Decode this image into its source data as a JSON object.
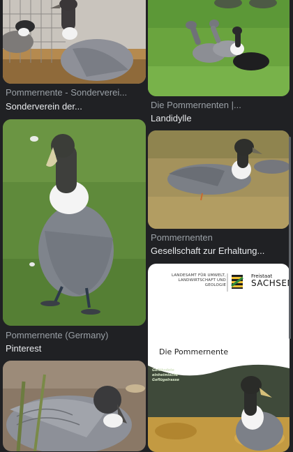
{
  "results": [
    {
      "source": "Pommernente - Sonderverei...",
      "title": "Sonderverein der..."
    },
    {
      "source": "Die Pommernenten |...",
      "title": "Landidylle"
    },
    {
      "source": "Pommernente (Germany)",
      "title": "Pinterest"
    },
    {
      "source": "Pommernenten",
      "title": "Gesellschaft zur Erhaltung..."
    },
    {
      "source": "",
      "title": ""
    },
    {
      "source": "",
      "title": ""
    }
  ],
  "document_thumbnail": {
    "agency": "LANDESAMT FÜR UMWELT, LANDWIRTSCHAFT UND GEOLOGIE",
    "state_small": "Freistaat",
    "state_big": "SACHSEN",
    "title": "Die Pommernente",
    "overlay": "Gefährdete einheimische Geflügelrasse"
  },
  "colors": {
    "background": "#202124",
    "source_text": "#9aa0a6",
    "title_text": "#e8eaed"
  }
}
